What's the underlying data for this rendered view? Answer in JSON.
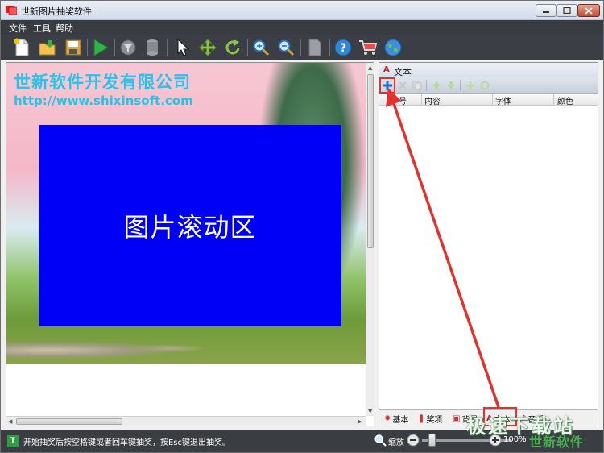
{
  "window": {
    "title": "世新图片抽奖软件"
  },
  "menu": {
    "items": [
      "文件",
      "工具",
      "帮助"
    ]
  },
  "toolbar": {
    "icons": [
      "new-file",
      "open-folder",
      "save",
      "play",
      "filter",
      "database",
      "pointer",
      "move",
      "refresh",
      "zoom-in",
      "zoom-out",
      "page",
      "help",
      "cart",
      "globe"
    ]
  },
  "canvas": {
    "company_name": "世新软件开发有限公司",
    "company_url": "http://www.shixinsoft.com",
    "scroll_area_label": "图片滚动区"
  },
  "text_panel": {
    "title": "文本",
    "toolbar_icons": [
      "add",
      "delete",
      "copy",
      "move-up",
      "move-down",
      "insert",
      "edit"
    ],
    "columns": [
      "序号",
      "内容",
      "字体",
      "颜色"
    ],
    "tabs": [
      {
        "label": "基本",
        "icon": "gear"
      },
      {
        "label": "奖项",
        "icon": "award"
      },
      {
        "label": "背景",
        "icon": "image"
      },
      {
        "label": "文本",
        "icon": "text"
      },
      {
        "label": "音乐",
        "icon": "music"
      }
    ],
    "active_tab": "文本"
  },
  "status": {
    "message": "开始抽奖后按空格键或者回车键抽奖，按Esc键退出抽奖。",
    "zoom_label": "缩放",
    "zoom_value": "100%"
  },
  "watermark": {
    "text": "极速下载站",
    "sub": "世新软件"
  },
  "colors": {
    "scroll_area": "#0000f7",
    "company_text": "#27c3e8",
    "annotation": "#e3312b",
    "toolbar_bg": "#3b3e44"
  }
}
